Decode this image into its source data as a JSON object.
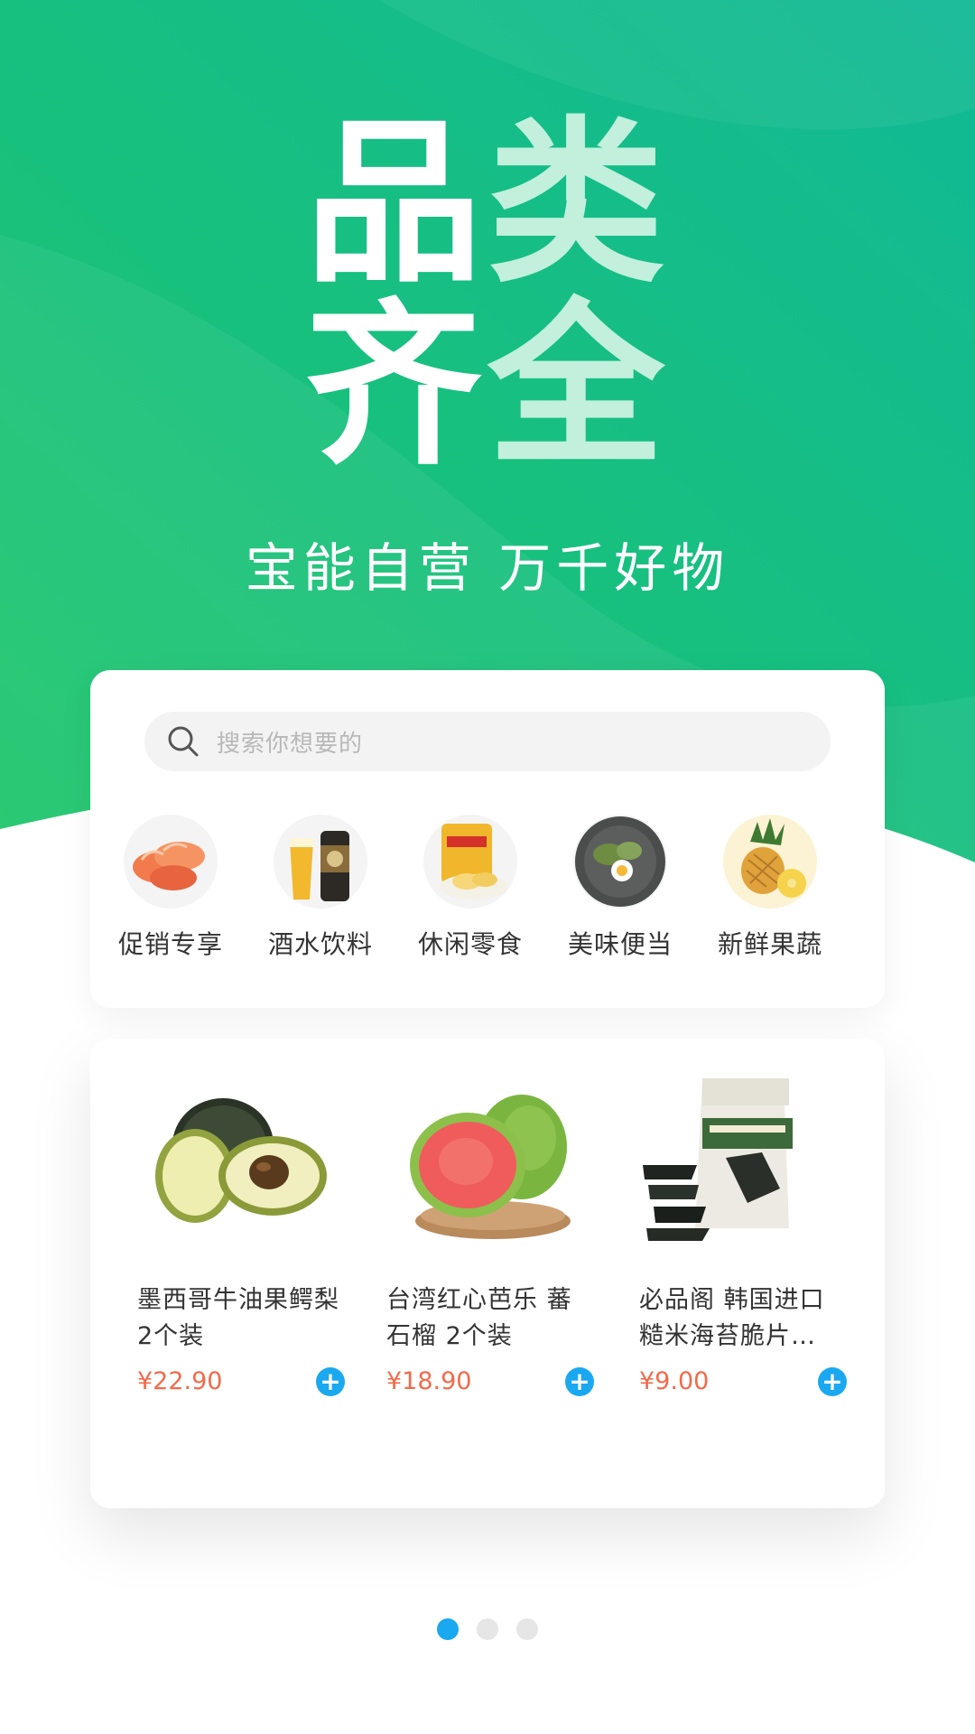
{
  "hero": {
    "title_line_1": [
      "品",
      "类"
    ],
    "title_line_2": [
      "齐",
      "全"
    ],
    "subtitle": "宝能自营  万千好物",
    "colors": {
      "gradient_start": "#1ec66a",
      "gradient_end": "#11b996"
    }
  },
  "search": {
    "placeholder": "搜索你想要的",
    "icon": "search-icon"
  },
  "categories": [
    {
      "label": "促销专享",
      "icon": "shrimp-image"
    },
    {
      "label": "酒水饮料",
      "icon": "beer-image"
    },
    {
      "label": "休闲零食",
      "icon": "chips-image"
    },
    {
      "label": "美味便当",
      "icon": "bento-image"
    },
    {
      "label": "新鲜果蔬",
      "icon": "pineapple-image"
    }
  ],
  "products": [
    {
      "name": "墨西哥牛油果鳄梨 2个装",
      "price": "¥22.90",
      "image": "avocado-image"
    },
    {
      "name": "台湾红心芭乐 蕃石榴 2个装",
      "price": "¥18.90",
      "image": "guava-image"
    },
    {
      "name": "必品阁 韩国进口糙米海苔脆片…",
      "price": "¥9.00",
      "image": "seaweed-crisps-image"
    }
  ],
  "add_button_symbol": "+",
  "pager": {
    "total": 3,
    "active": 1
  },
  "colors": {
    "price": "#f26a4b",
    "accent": "#1aa8f0"
  }
}
